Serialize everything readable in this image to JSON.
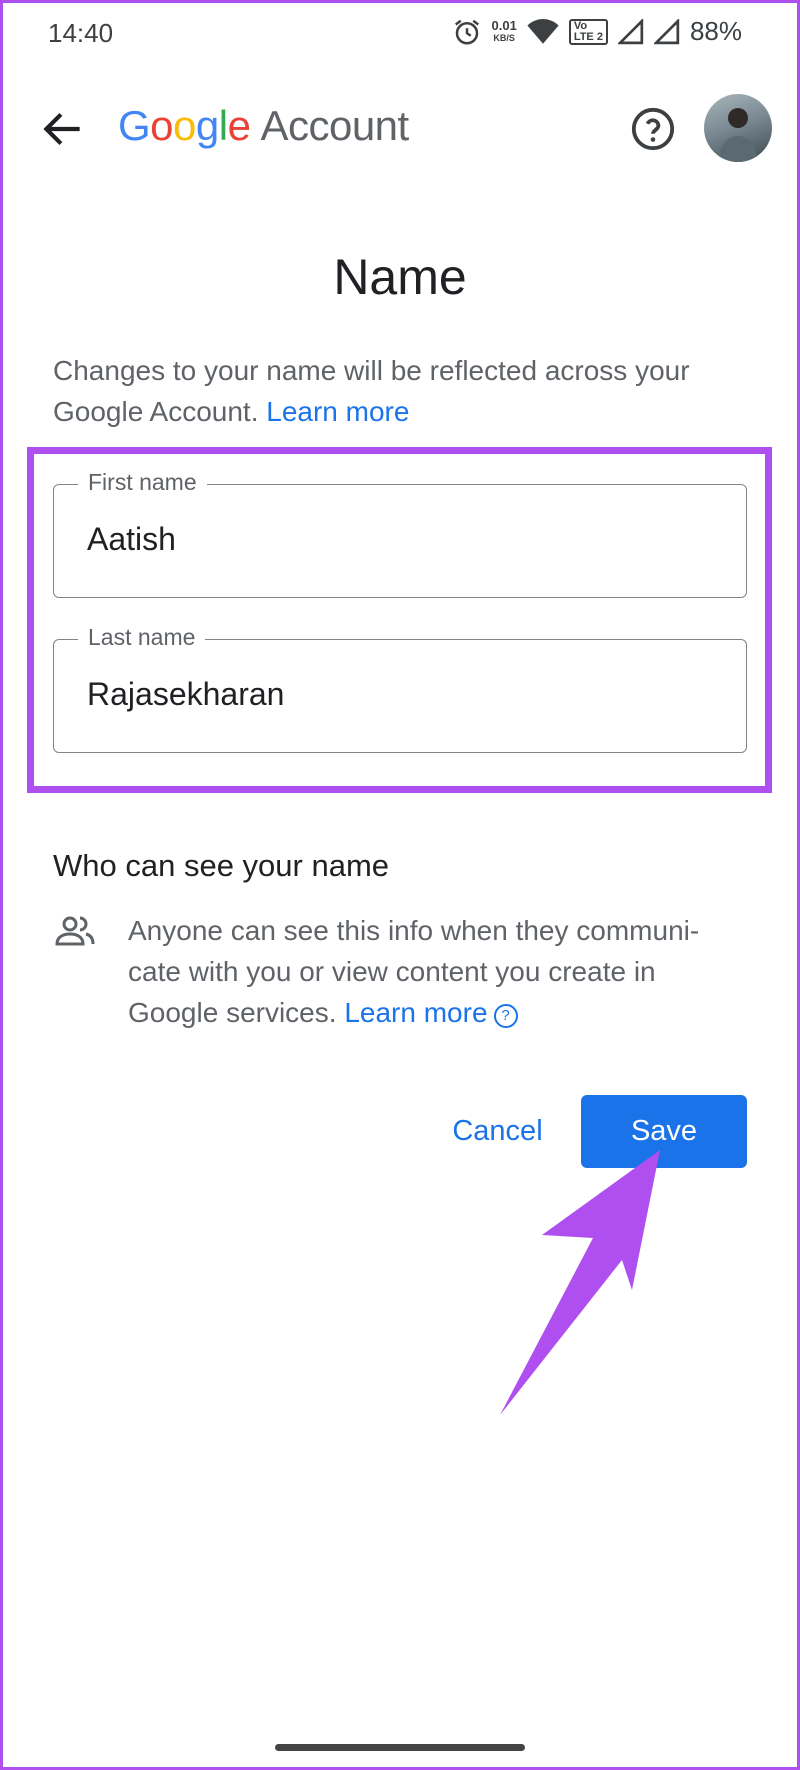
{
  "status_bar": {
    "time": "14:40",
    "net_speed": "0.01",
    "net_unit": "KB/S",
    "lte_top": "Vo",
    "lte_bottom": "LTE 2",
    "battery": "88%"
  },
  "app_bar": {
    "brand_letters": [
      "G",
      "o",
      "o",
      "g",
      "l",
      "e"
    ],
    "brand_suffix": "Account"
  },
  "page": {
    "title": "Name",
    "intro": "Changes to your name will be reflected across your Google Account.",
    "intro_link": "Learn more"
  },
  "form": {
    "first_name": {
      "label": "First name",
      "value": "Aatish"
    },
    "last_name": {
      "label": "Last name",
      "value": "Rajasekharan"
    }
  },
  "visibility": {
    "heading": "Who can see your name",
    "text": "Anyone can see this info when they communi-cate with you or view content you create in Google services.",
    "link": "Learn more",
    "help_glyph": "?"
  },
  "actions": {
    "cancel": "Cancel",
    "save": "Save"
  },
  "colors": {
    "accent": "#1a73e8",
    "highlight": "#b04ff0",
    "arrow": "#b04ff0"
  }
}
